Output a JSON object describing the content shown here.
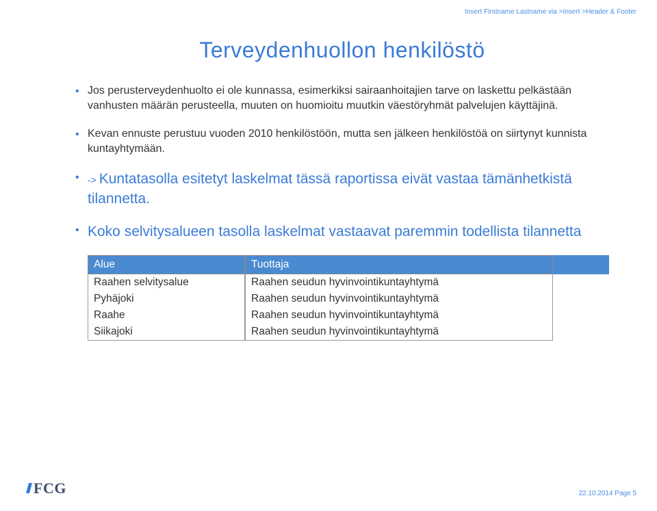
{
  "header_note": "Insert Firstname Lastname via >Insert >Header & Footer",
  "title": "Terveydenhuollon henkilöstö",
  "bullets": [
    {
      "text": "Jos perusterveydenhuolto ei ole kunnassa, esimerkiksi sairaanhoitajien tarve on laskettu pelkästään vanhusten määrän perusteella, muuten on huomioitu muutkin väestöryhmät palvelujen käyttäjinä.",
      "style": "normal"
    },
    {
      "text": "Kevan ennuste perustuu vuoden 2010 henkilöstöön, mutta sen jälkeen henkilöstöä on siirtynyt kunnista kuntayhtymään.",
      "style": "normal"
    },
    {
      "arrow": "-> ",
      "text": "Kuntatasolla esitetyt laskelmat tässä raportissa eivät vastaa tämänhetkistä tilannetta.",
      "style": "emph"
    },
    {
      "text": "Koko selvitysalueen tasolla laskelmat vastaavat paremmin todellista tilannetta",
      "style": "emph"
    }
  ],
  "table": {
    "header": {
      "a": "Alue",
      "b": "Tuottaja"
    },
    "rows": [
      {
        "a": "Raahen selvitysalue",
        "b": "Raahen seudun hyvinvointikuntayhtymä"
      },
      {
        "a": "Pyhäjoki",
        "b": "Raahen seudun hyvinvointikuntayhtymä"
      },
      {
        "a": "Raahe",
        "b": "Raahen seudun hyvinvointikuntayhtymä"
      },
      {
        "a": "Siikajoki",
        "b": "Raahen seudun hyvinvointikuntayhtymä"
      }
    ]
  },
  "logo": "FCG",
  "page_info": "22.10.2014  Page 5"
}
